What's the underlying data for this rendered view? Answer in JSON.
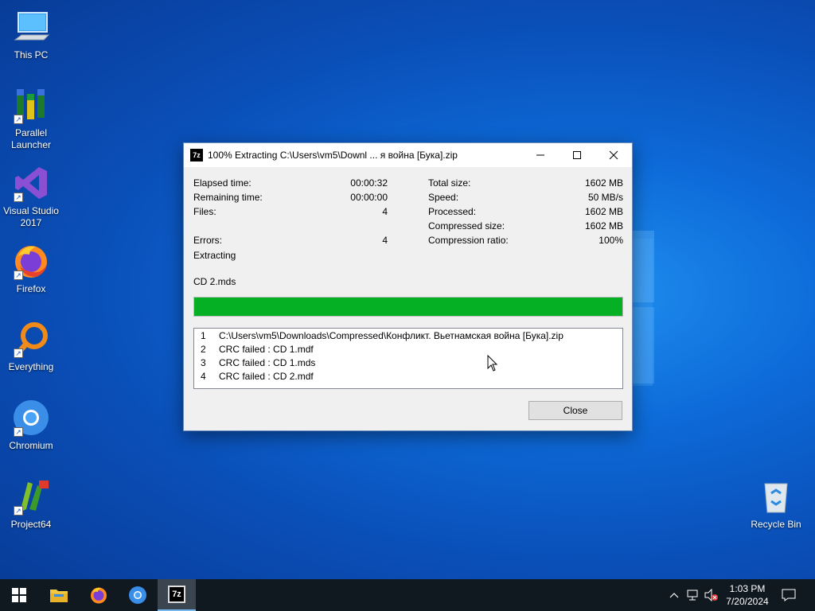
{
  "desktop": {
    "icons": [
      {
        "label": "This PC",
        "icon": "computer-icon"
      },
      {
        "label": "Parallel Launcher",
        "icon": "parallel-launcher-icon"
      },
      {
        "label": "Visual Studio 2017",
        "icon": "visual-studio-icon"
      },
      {
        "label": "Firefox",
        "icon": "firefox-icon"
      },
      {
        "label": "Everything",
        "icon": "everything-search-icon"
      },
      {
        "label": "Chromium",
        "icon": "chromium-icon"
      },
      {
        "label": "Project64",
        "icon": "project64-icon"
      },
      {
        "label": "Recycle Bin",
        "icon": "recycle-bin-icon"
      }
    ]
  },
  "dialog": {
    "app_icon_text": "7z",
    "title": "100% Extracting C:\\Users\\vm5\\Downl ... я война [Бука].zip",
    "stats_left": [
      {
        "label": "Elapsed time:",
        "value": "00:00:32"
      },
      {
        "label": "Remaining time:",
        "value": "00:00:00"
      },
      {
        "label": "Files:",
        "value": "4"
      },
      {
        "label": "Errors:",
        "value": "4"
      }
    ],
    "stats_right": [
      {
        "label": "Total size:",
        "value": "1602 MB"
      },
      {
        "label": "Speed:",
        "value": "50 MB/s"
      },
      {
        "label": "Processed:",
        "value": "1602 MB"
      },
      {
        "label": "Compressed size:",
        "value": "1602 MB"
      },
      {
        "label": "Compression ratio:",
        "value": "100%"
      }
    ],
    "status": "Extracting",
    "current_file": "CD 2.mds",
    "progress_percent": 100,
    "messages": [
      {
        "num": "1",
        "text": "C:\\Users\\vm5\\Downloads\\Compressed\\Конфликт. Вьетнамская война [Бука].zip"
      },
      {
        "num": "2",
        "text": "CRC failed : CD 1.mdf"
      },
      {
        "num": "3",
        "text": "CRC failed : CD 1.mds"
      },
      {
        "num": "4",
        "text": "CRC failed : CD 2.mdf"
      }
    ],
    "close_label": "Close"
  },
  "taskbar": {
    "apps": [
      "start-icon",
      "file-explorer-icon",
      "firefox-icon",
      "chromium-icon",
      "7zip-icon"
    ],
    "active_app_text": "7z",
    "clock_time": "1:03 PM",
    "clock_date": "7/20/2024"
  },
  "colors": {
    "progress_fill": "#06b025",
    "taskbar": "#101820",
    "desktop": "#0a4fb8"
  }
}
